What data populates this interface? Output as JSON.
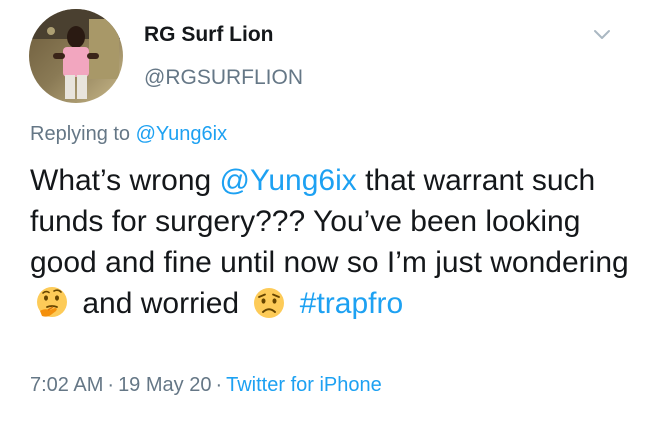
{
  "tweet": {
    "author": {
      "display_name": "RG Surf Lion",
      "handle": "@RGSURFLION",
      "avatar": "profile-photo"
    },
    "menu_icon": "chevron-down-icon",
    "replying_prefix": "Replying to",
    "replying_handle": "@Yung6ix",
    "text": {
      "p1": "What’s wrong ",
      "mention": "@Yung6ix",
      "p2": " that warrant such funds for surgery??? You’ve been looking good and fine until now so I’m just wondering ",
      "emoji1": "thinking-face-emoji",
      "p3": " and worried ",
      "emoji2": "worried-face-emoji",
      "p4": " ",
      "hashtag": "#trapfro"
    },
    "time": "7:02 AM",
    "date": "19 May 20",
    "separator": "·",
    "source": "Twitter for iPhone"
  },
  "colors": {
    "link": "#1da1f2",
    "secondary_text": "#657786",
    "primary_text": "#14171a",
    "emoji_yellow": "#fdcb58"
  }
}
